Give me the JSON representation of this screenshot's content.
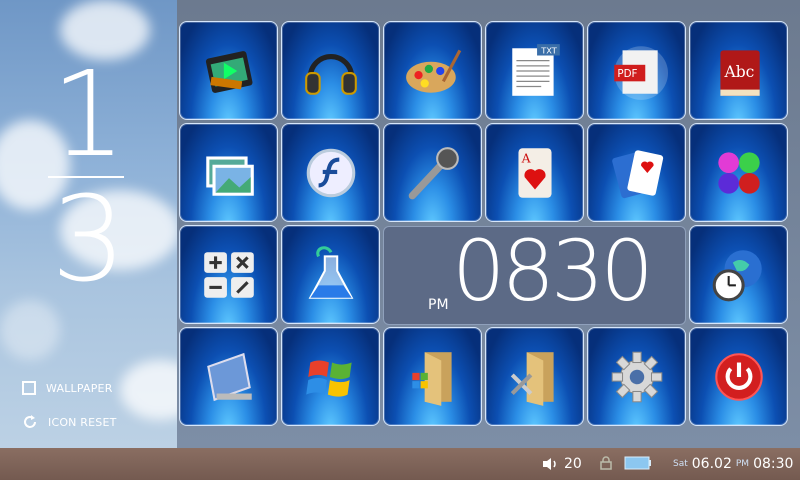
{
  "pager": {
    "current": "1",
    "total": "3"
  },
  "options": {
    "wallpaper_label": "WALLPAPER",
    "icon_reset_label": "ICON RESET"
  },
  "tiles": [
    {
      "icon": "video-film-icon"
    },
    {
      "icon": "headphones-icon"
    },
    {
      "icon": "paint-palette-icon"
    },
    {
      "icon": "txt-document-icon",
      "badge": "TXT"
    },
    {
      "icon": "pdf-document-icon",
      "badge": "PDF"
    },
    {
      "icon": "dictionary-book-icon",
      "badge": "Abc"
    },
    {
      "icon": "photos-icon"
    },
    {
      "icon": "flash-player-icon"
    },
    {
      "icon": "microphone-icon"
    },
    {
      "icon": "ace-of-hearts-card-icon",
      "badge": "A"
    },
    {
      "icon": "playing-cards-icon"
    },
    {
      "icon": "colored-balls-icon"
    },
    {
      "icon": "calculator-icon"
    },
    {
      "icon": "science-flask-icon"
    },
    {
      "icon": "world-clock-icon"
    },
    {
      "icon": "music-player-icon"
    },
    {
      "icon": "windows-logo-icon"
    },
    {
      "icon": "windows-folder-icon"
    },
    {
      "icon": "tools-folder-icon"
    },
    {
      "icon": "settings-gear-icon"
    },
    {
      "icon": "power-icon"
    }
  ],
  "clock": {
    "ampm": "PM",
    "time": "08:30",
    "display_digits": "0830"
  },
  "status_bar": {
    "volume": "20",
    "day": "Sat",
    "date": "06.02",
    "ampm": "PM",
    "time": "08:30"
  },
  "colors": {
    "tile_dark": "#062f7a",
    "tile_light": "#5fc9ff",
    "status_bar": "#7a5f55",
    "power_red": "#d21f1f"
  }
}
